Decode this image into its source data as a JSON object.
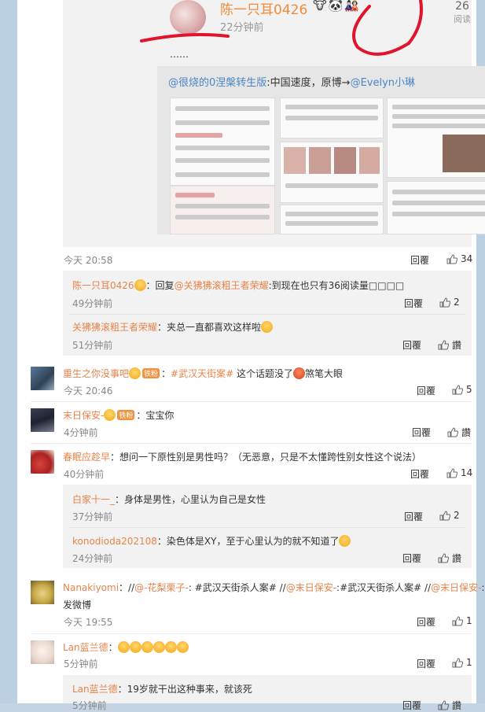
{
  "post": {
    "author": "陈一只耳0426",
    "author_badges": "🐮🐼🎎",
    "time": "22分钟前",
    "read_count": "26",
    "read_label": "阅读",
    "ellipsis": "……",
    "repost": {
      "prefix": "@很烧的0涅槃转生版",
      "middle": ":中国速度，原博→",
      "link": "@Evelyn小琳"
    },
    "posted_time": "今天 20:58",
    "reply_label": "回覆",
    "likes": "34"
  },
  "comments": [
    {
      "id": "c1",
      "name": "陈一只耳0426",
      "text": "：回复",
      "mention": "@关狒狒滚粗王者荣耀",
      "text2": ":到现在也只有36阅读量□□□□",
      "time": "49分钟前",
      "reply": "回覆",
      "likes": "2"
    },
    {
      "id": "c2",
      "name": "关狒狒滚粗王者荣耀",
      "text": "：夹总一直都喜欢这样啦",
      "time": "51分钟前",
      "reply": "回覆",
      "likes": "讚"
    },
    {
      "id": "c3",
      "name": "重生之你没事吧",
      "fan": "铁粉",
      "topic": "#武汉天街案#",
      "text": " 这个话题没了",
      "text2": "煞笔大眼",
      "time": "今天 20:46",
      "reply": "回覆",
      "likes": "5"
    },
    {
      "id": "c4",
      "name": "末日保安-",
      "fan": "铁粉",
      "text": "：宝宝你",
      "time": "4分钟前",
      "reply": "回覆",
      "likes": "讚"
    },
    {
      "id": "c5",
      "name": "春眠应趁早",
      "text": "：想问一下原性别是男性吗？（无恶意，只是不太懂跨性别女性这个说法）",
      "time": "40分钟前",
      "reply": "回覆",
      "likes": "14"
    },
    {
      "id": "c6",
      "name": "白家十一_",
      "text": "：身体是男性，心里认为自己是女性",
      "time": "37分钟前",
      "reply": "回覆",
      "likes": "2"
    },
    {
      "id": "c7",
      "name": "konodioda202108",
      "text": "：染色体是XY，至于心里认为的就不知道了",
      "time": "24分钟前",
      "reply": "回覆",
      "likes": "讚"
    },
    {
      "id": "c8",
      "name": "Nanakiyomi",
      "line1_pre": "：//",
      "m1": "@-花梨栗子-",
      "line1_b": ": #武汉天街杀人案# //",
      "m2": "@末日保安-",
      "line1_c": ":#武汉天街杀人案# //",
      "m3": "@末日保安-",
      "line1_d": ":转",
      "line2": "发微博",
      "time": "今天 19:55",
      "reply": "回覆",
      "likes": "1"
    },
    {
      "id": "c9",
      "name": "Lan蓝兰德",
      "text": "：",
      "emojis": "😭😭😭😭😭😭",
      "time": "5分钟前",
      "reply": "回覆",
      "likes": "1"
    },
    {
      "id": "c10",
      "name": "Lan蓝兰德",
      "text": "：19岁就干出这种事来，就该死",
      "time": "5分钟前",
      "reply": "回覆",
      "likes": "讚"
    }
  ],
  "colors": {
    "accent": "#e8834a",
    "link": "#4a86c5",
    "page_bg": "#c5d4e3",
    "annotation": "#e0142c"
  }
}
